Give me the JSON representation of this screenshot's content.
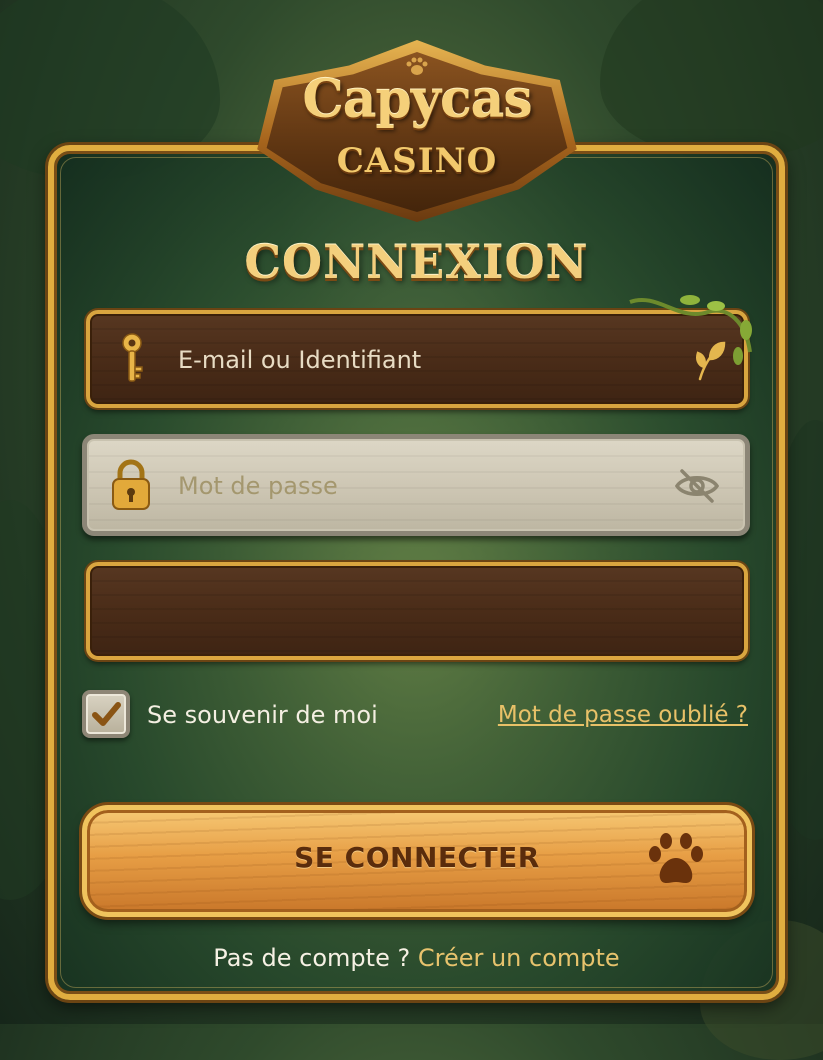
{
  "brand": {
    "title": "Capycas",
    "subtitle": "CASINO",
    "paw_icon": "paw-icon"
  },
  "heading": "CONNEXION",
  "form": {
    "email": {
      "placeholder": "E-mail ou Identifiant",
      "value": "",
      "icon": "key-icon",
      "trailing_icon": "leaf-icon"
    },
    "password": {
      "placeholder": "Mot de passe",
      "value": "",
      "icon": "lock-icon",
      "trailing_icon": "eye-slash-icon"
    },
    "extra": {
      "value": ""
    },
    "remember": {
      "label": "Se souvenir de moi",
      "checked": true
    },
    "forgot_link": "Mot de passe oublié ?",
    "submit_label": "SE CONNECTER",
    "submit_icon": "paw-icon"
  },
  "footer": {
    "question": "Pas de compte ?",
    "link": "Créer un compte"
  },
  "colors": {
    "gold": "#e0ad3f",
    "wood_dark": "#4a2c18",
    "stone": "#cbc4b1",
    "button_orange": "#e79e45",
    "link_gold": "#e8c168"
  }
}
